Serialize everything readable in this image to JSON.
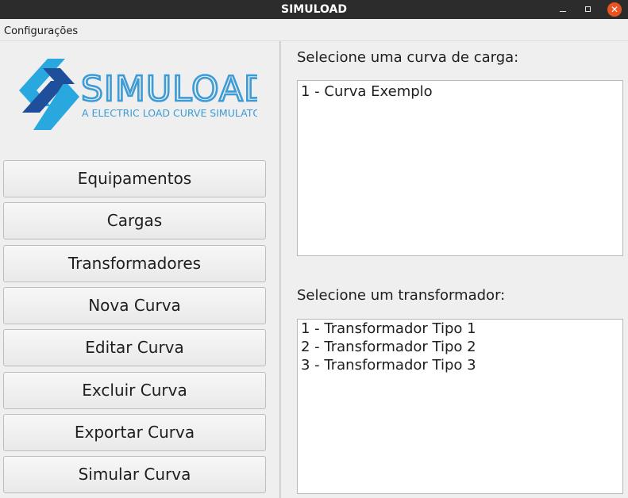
{
  "window": {
    "title": "SIMULOAD",
    "controls": {
      "minimize_icon": "minimize-icon",
      "maximize_icon": "maximize-icon",
      "close_icon": "close-icon",
      "close_glyph": "✕"
    }
  },
  "menubar": {
    "items": [
      {
        "label": "Configurações"
      }
    ]
  },
  "logo": {
    "wordmark": "SIMULOAD",
    "tagline": "A ELECTRIC LOAD CURVE SIMULATOR",
    "colors": {
      "light_blue": "#29a8e0",
      "dark_blue": "#1f4e9a",
      "text_blue": "#3d9bd6"
    }
  },
  "sidebar": {
    "buttons": [
      {
        "label": "Equipamentos"
      },
      {
        "label": "Cargas"
      },
      {
        "label": "Transformadores"
      },
      {
        "label": "Nova Curva"
      },
      {
        "label": "Editar Curva"
      },
      {
        "label": "Excluir Curva"
      },
      {
        "label": "Exportar Curva"
      },
      {
        "label": "Simular Curva"
      }
    ]
  },
  "curves": {
    "label": "Selecione uma curva de carga:",
    "items": [
      "1 - Curva Exemplo"
    ]
  },
  "transformers": {
    "label": "Selecione um transformador:",
    "items": [
      "1 - Transformador Tipo 1",
      "2 - Transformador Tipo 2",
      "3 - Transformador Tipo 3"
    ]
  }
}
